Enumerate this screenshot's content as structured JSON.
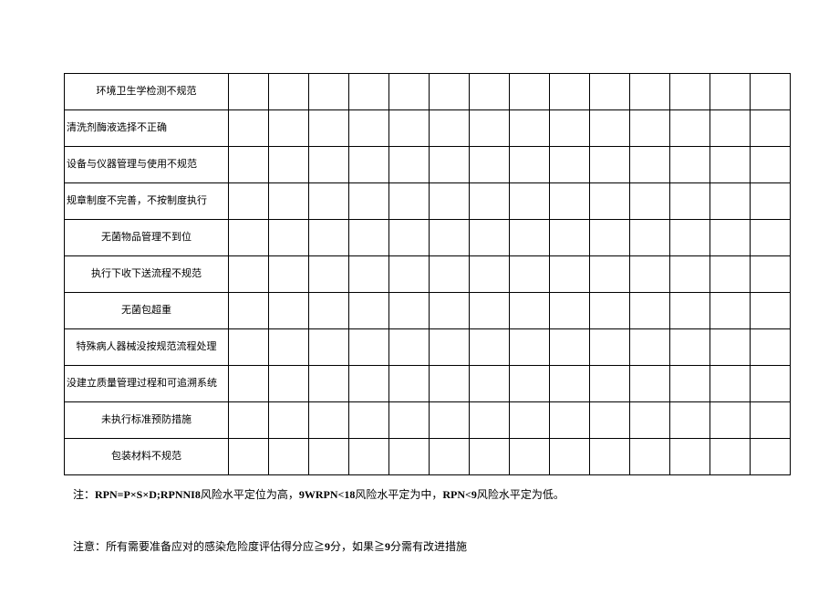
{
  "table": {
    "rows": [
      {
        "label": "环境卫生学检测不规范",
        "align": "center"
      },
      {
        "label": "清洗剂酶液选择不正确",
        "align": "left"
      },
      {
        "label": "设备与仪器管理与使用不规范",
        "align": "left"
      },
      {
        "label": "规章制度不完善，不按制度执行",
        "align": "left"
      },
      {
        "label": "无菌物品管理不到位",
        "align": "center"
      },
      {
        "label": "执行下收下送流程不规范",
        "align": "center"
      },
      {
        "label": "无菌包超重",
        "align": "center"
      },
      {
        "label": "特殊病人器械没按规范流程处理",
        "align": "center"
      },
      {
        "label": "没建立质量管理过程和可追溯系统",
        "align": "left"
      },
      {
        "label": "未执行标准预防措施",
        "align": "center"
      },
      {
        "label": "包装材料不规范",
        "align": "center"
      }
    ]
  },
  "footer": {
    "note_prefix": "注：",
    "note_bold1": "RPN=P×S×D;RPNNI8",
    "note_mid1": "风险水平定位为高，",
    "note_bold2": "9WRPN<18",
    "note_mid2": "风险水平定为中，",
    "note_bold3": "RPN<9",
    "note_end": "风险水平定为低。",
    "note2_prefix": "注意：所有需要准备应对的感染危险度评估得分应≧",
    "note2_bold1": "9",
    "note2_mid": "分，如果≧",
    "note2_bold2": "9",
    "note2_end": "分需有改进措施"
  }
}
